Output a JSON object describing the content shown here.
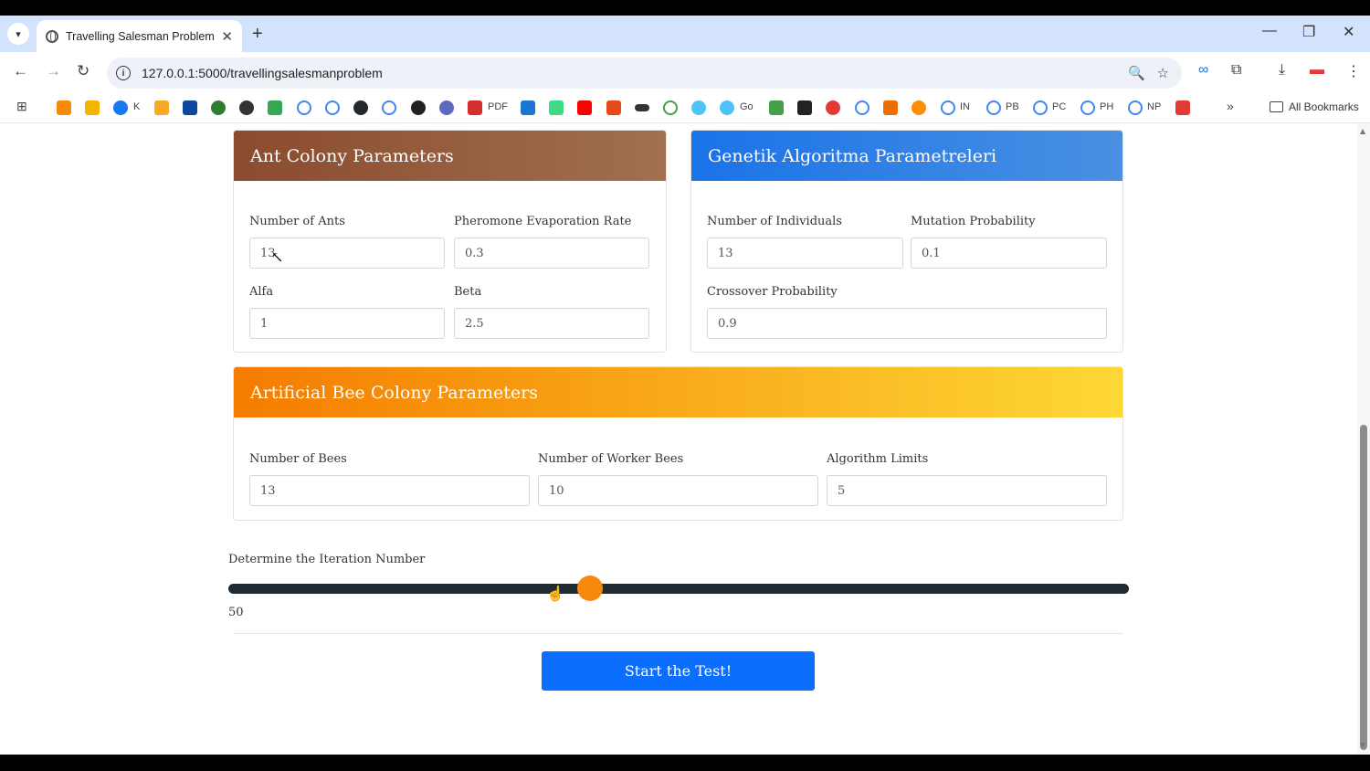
{
  "browser": {
    "tab_title": "Travelling Salesman Problem",
    "url": "127.0.0.1:5000/travellingsalesmanproblem",
    "all_bookmarks_label": "All Bookmarks",
    "bookmark_labels": [
      "K",
      "PDF",
      "Go",
      "IN",
      "PB",
      "PC",
      "PH",
      "NP"
    ]
  },
  "ant_colony": {
    "title": "Ant Colony Parameters",
    "fields": [
      {
        "label": "Number of Ants",
        "value": "13"
      },
      {
        "label": "Pheromone Evaporation Rate",
        "value": "0.3"
      },
      {
        "label": "Alfa",
        "value": "1"
      },
      {
        "label": "Beta",
        "value": "2.5"
      }
    ]
  },
  "genetic": {
    "title": "Genetik Algoritma Parametreleri",
    "fields": [
      {
        "label": "Number of Individuals",
        "value": "13"
      },
      {
        "label": "Mutation Probability",
        "value": "0.1"
      },
      {
        "label": "Crossover Probability",
        "value": "0.9"
      }
    ]
  },
  "bee_colony": {
    "title": "Artificial Bee Colony Parameters",
    "fields": [
      {
        "label": "Number of Bees",
        "value": "13"
      },
      {
        "label": "Number of Worker Bees",
        "value": "10"
      },
      {
        "label": "Algorithm Limits",
        "value": "5"
      }
    ]
  },
  "iteration": {
    "label": "Determine the Iteration Number",
    "value": "50",
    "slider_fraction": 0.402
  },
  "start_button_label": "Start the Test!",
  "colors": {
    "ant_header": "#8b4b2e",
    "genetic_header": "#1a73e8",
    "bee_header": "#f57c00",
    "slider_thumb": "#f7890d",
    "start_button": "#0b6efd"
  }
}
